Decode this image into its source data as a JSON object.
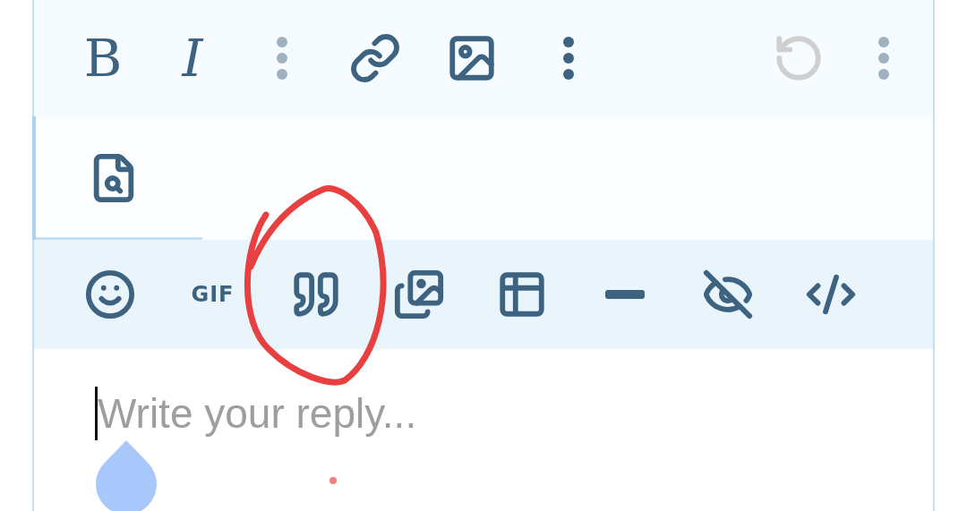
{
  "toolbar_top": [
    {
      "label": "B",
      "disabled": false
    },
    {
      "label": "I",
      "disabled": false
    },
    {
      "disabled": true
    },
    {
      "disabled": false
    },
    {
      "disabled": false
    },
    {
      "disabled": false
    }
  ],
  "toolbar_top_right": [
    {
      "disabled": true
    },
    {
      "disabled": true
    }
  ],
  "toolbar_middle": [
    {
      "disabled": false
    }
  ],
  "toolbar_insert": [
    {
      "disabled": false
    },
    {
      "label": "GIF",
      "disabled": false
    },
    {
      "disabled": false
    },
    {
      "disabled": false
    },
    {
      "disabled": false
    },
    {
      "disabled": false
    },
    {
      "disabled": false
    },
    {
      "disabled": false
    }
  ],
  "editor": {
    "placeholder": "Write your reply..."
  }
}
